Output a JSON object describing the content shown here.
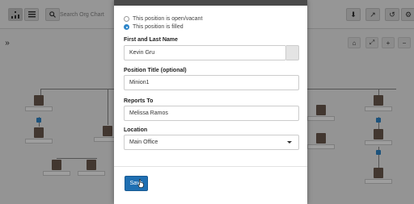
{
  "toolbar": {
    "search_placeholder": "Search Org Chart"
  },
  "modal": {
    "radio_options": [
      {
        "label": "This position is open/vacant",
        "checked": false
      },
      {
        "label": "This position is filled",
        "checked": true
      }
    ],
    "name": {
      "label": "First and Last Name",
      "value": "Kevin Gru"
    },
    "title": {
      "label": "Position Title (optional)",
      "value": "Minion1"
    },
    "reports_to": {
      "label": "Reports To",
      "value": "Melissa Ramos"
    },
    "location": {
      "label": "Location",
      "value": "Main Office"
    },
    "save_label": "Save"
  },
  "colors": {
    "accent": "#2f86c9",
    "save_button": "#1f6fb2",
    "modal_header": "#4a4a4a"
  }
}
